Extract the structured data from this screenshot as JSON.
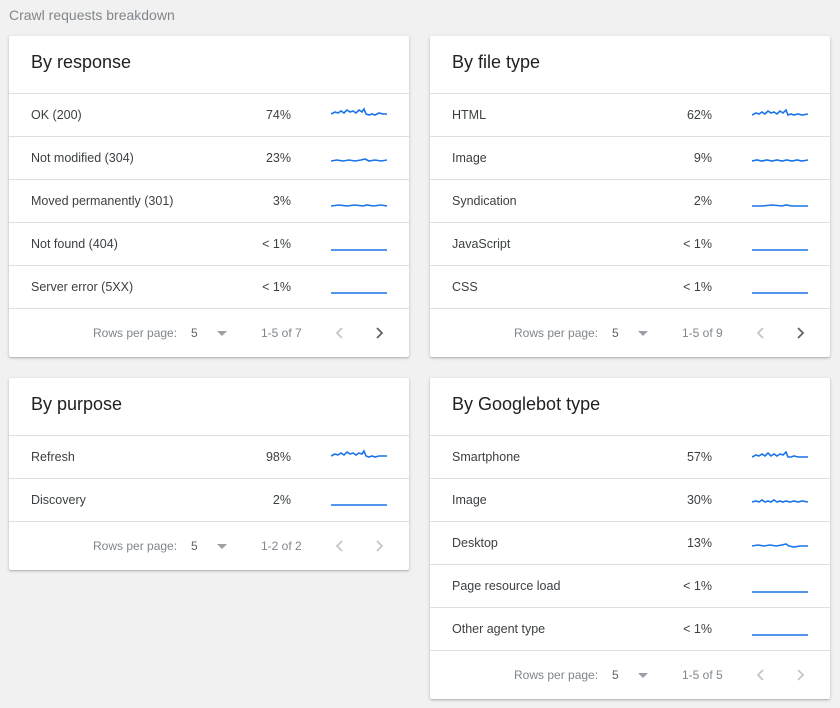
{
  "page_title": "Crawl requests breakdown",
  "accent_color": "#1a73e8",
  "pagination_label": "Rows per page:",
  "cards": {
    "response": {
      "title": "By response",
      "rows": [
        {
          "label": "OK (200)",
          "pct": "74%"
        },
        {
          "label": "Not modified (304)",
          "pct": "23%"
        },
        {
          "label": "Moved permanently (301)",
          "pct": "3%"
        },
        {
          "label": "Not found (404)",
          "pct": "< 1%"
        },
        {
          "label": "Server error (5XX)",
          "pct": "< 1%"
        }
      ],
      "rows_per_page": "5",
      "range": "1-5 of 7"
    },
    "file_type": {
      "title": "By file type",
      "rows": [
        {
          "label": "HTML",
          "pct": "62%"
        },
        {
          "label": "Image",
          "pct": "9%"
        },
        {
          "label": "Syndication",
          "pct": "2%"
        },
        {
          "label": "JavaScript",
          "pct": "< 1%"
        },
        {
          "label": "CSS",
          "pct": "< 1%"
        }
      ],
      "rows_per_page": "5",
      "range": "1-5 of 9"
    },
    "purpose": {
      "title": "By purpose",
      "rows": [
        {
          "label": "Refresh",
          "pct": "98%"
        },
        {
          "label": "Discovery",
          "pct": "2%"
        }
      ],
      "rows_per_page": "5",
      "range": "1-2 of 2"
    },
    "googlebot": {
      "title": "By Googlebot type",
      "rows": [
        {
          "label": "Smartphone",
          "pct": "57%"
        },
        {
          "label": "Image",
          "pct": "30%"
        },
        {
          "label": "Desktop",
          "pct": "13%"
        },
        {
          "label": "Page resource load",
          "pct": "< 1%"
        },
        {
          "label": "Other agent type",
          "pct": "< 1%"
        }
      ],
      "rows_per_page": "5",
      "range": "1-5 of 5"
    }
  }
}
